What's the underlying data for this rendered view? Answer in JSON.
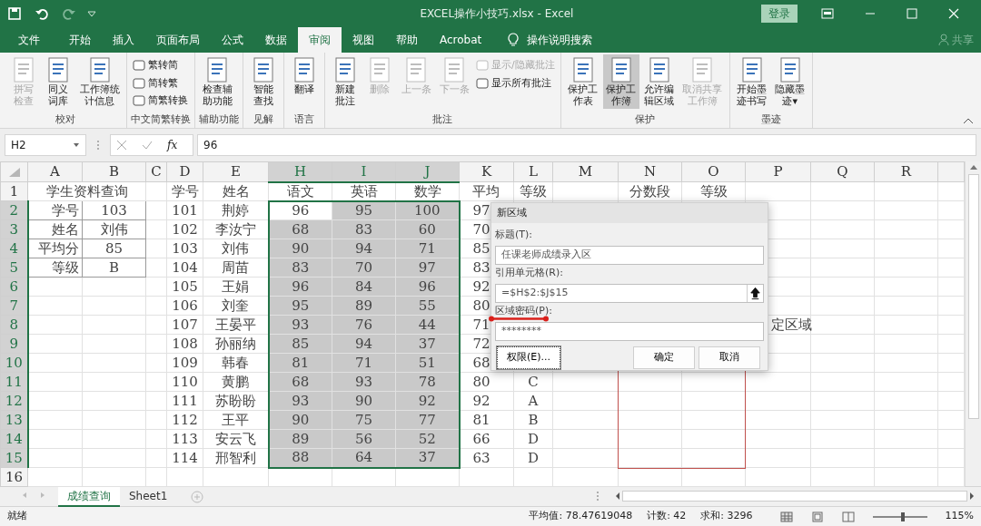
{
  "title_bar": {
    "title": "EXCEL操作小技巧.xlsx  -  Excel",
    "login": "登录"
  },
  "menu_tabs": [
    {
      "label": "文件",
      "selected": false
    },
    {
      "label": "开始",
      "selected": false
    },
    {
      "label": "插入",
      "selected": false
    },
    {
      "label": "页面布局",
      "selected": false
    },
    {
      "label": "公式",
      "selected": false
    },
    {
      "label": "数据",
      "selected": false
    },
    {
      "label": "审阅",
      "selected": true
    },
    {
      "label": "视图",
      "selected": false
    },
    {
      "label": "帮助",
      "selected": false
    },
    {
      "label": "Acrobat",
      "selected": false
    }
  ],
  "tell_me": "操作说明搜索",
  "share": "共享",
  "ribbon": [
    {
      "label": "校对",
      "buttons": [
        {
          "kind": "large",
          "label": "拼写检查",
          "disabled": true,
          "selected": false
        },
        {
          "kind": "large",
          "label": "同义词库",
          "disabled": false,
          "selected": false
        },
        {
          "kind": "large",
          "label": "工作簿统计信息",
          "disabled": false,
          "selected": false
        }
      ]
    },
    {
      "label": "中文简繁转换",
      "buttons": [
        {
          "kind": "small",
          "label": "繁转简",
          "disabled": false,
          "selected": false
        },
        {
          "kind": "small",
          "label": "简转繁",
          "disabled": false,
          "selected": false
        },
        {
          "kind": "small",
          "label": "简繁转换",
          "disabled": false,
          "selected": false
        }
      ]
    },
    {
      "label": "辅助功能",
      "buttons": [
        {
          "kind": "large",
          "label": "检查辅助功能",
          "disabled": false,
          "selected": false
        }
      ]
    },
    {
      "label": "见解",
      "buttons": [
        {
          "kind": "large",
          "label": "智能查找",
          "disabled": false,
          "selected": false
        }
      ]
    },
    {
      "label": "语言",
      "buttons": [
        {
          "kind": "large",
          "label": "翻译",
          "disabled": false,
          "selected": false
        }
      ]
    },
    {
      "label": "批注",
      "buttons": [
        {
          "kind": "large",
          "label": "新建批注",
          "disabled": false,
          "selected": false
        },
        {
          "kind": "large",
          "label": "删除",
          "disabled": true,
          "selected": false
        },
        {
          "kind": "large",
          "label": "上一条",
          "disabled": true,
          "selected": false
        },
        {
          "kind": "large",
          "label": "下一条",
          "disabled": true,
          "selected": false
        },
        {
          "kind": "small",
          "label": "显示/隐藏批注",
          "disabled": true,
          "selected": false
        },
        {
          "kind": "small",
          "label": "显示所有批注",
          "disabled": false,
          "selected": false
        }
      ]
    },
    {
      "label": "保护",
      "buttons": [
        {
          "kind": "large",
          "label": "保护工作表",
          "disabled": false,
          "selected": false
        },
        {
          "kind": "large",
          "label": "保护工作簿",
          "disabled": false,
          "selected": true
        },
        {
          "kind": "large",
          "label": "允许编辑区域",
          "disabled": false,
          "selected": false
        },
        {
          "kind": "large",
          "label": "取消共享工作簿",
          "disabled": true,
          "selected": false
        }
      ]
    },
    {
      "label": "墨迹",
      "buttons": [
        {
          "kind": "large",
          "label": "开始墨迹书写",
          "disabled": false,
          "selected": false
        },
        {
          "kind": "large",
          "label": "隐藏墨迹▾",
          "disabled": false,
          "selected": false
        }
      ]
    }
  ],
  "formula_bar": {
    "name_box": "H2",
    "function_label": "fx",
    "value": "96"
  },
  "sheet": {
    "columns": [
      {
        "letter": "A",
        "selected": false
      },
      {
        "letter": "B",
        "selected": false
      },
      {
        "letter": "C",
        "selected": false
      },
      {
        "letter": "D",
        "selected": false
      },
      {
        "letter": "E",
        "selected": false
      },
      {
        "letter": "H",
        "selected": true
      },
      {
        "letter": "I",
        "selected": true
      },
      {
        "letter": "J",
        "selected": true
      },
      {
        "letter": "K",
        "selected": false
      },
      {
        "letter": "L",
        "selected": false
      },
      {
        "letter": "M",
        "selected": false
      },
      {
        "letter": "N",
        "selected": false
      },
      {
        "letter": "O",
        "selected": false
      },
      {
        "letter": "P",
        "selected": false
      },
      {
        "letter": "Q",
        "selected": false
      },
      {
        "letter": "R",
        "selected": false
      }
    ],
    "rows": [
      {
        "number": "1",
        "selected": false,
        "boxed": false,
        "cells": {
          "A": {
            "text": "学生资料查询",
            "merged": true
          },
          "D": "学号",
          "E": "姓名",
          "H": "语文",
          "I": "英语",
          "J": "数学",
          "K": "平均",
          "L": "等级",
          "N": "分数段",
          "O": "等级"
        }
      },
      {
        "number": "2",
        "selected": true,
        "boxed": true,
        "cells": {
          "A": "学号",
          "B": "103",
          "D": "101",
          "E": "荆婷",
          "H": "96",
          "I": "95",
          "J": "100",
          "K": "97"
        }
      },
      {
        "number": "3",
        "selected": true,
        "boxed": true,
        "cells": {
          "A": "姓名",
          "B": "刘伟",
          "D": "102",
          "E": "李汝宁",
          "H": "68",
          "I": "83",
          "J": "60",
          "K": "70"
        }
      },
      {
        "number": "4",
        "selected": true,
        "boxed": true,
        "cells": {
          "A": "平均分",
          "B": "85",
          "D": "103",
          "E": "刘伟",
          "H": "90",
          "I": "94",
          "J": "71",
          "K": "85"
        }
      },
      {
        "number": "5",
        "selected": true,
        "boxed": true,
        "cells": {
          "A": "等级",
          "B": "B",
          "D": "104",
          "E": "周苗",
          "H": "83",
          "I": "70",
          "J": "97",
          "K": "83"
        }
      },
      {
        "number": "6",
        "selected": true,
        "boxed": false,
        "cells": {
          "D": "105",
          "E": "王娟",
          "H": "96",
          "I": "84",
          "J": "96",
          "K": "92"
        }
      },
      {
        "number": "7",
        "selected": true,
        "boxed": false,
        "cells": {
          "D": "106",
          "E": "刘奎",
          "H": "95",
          "I": "89",
          "J": "55",
          "K": "80"
        }
      },
      {
        "number": "8",
        "selected": true,
        "boxed": false,
        "cells": {
          "D": "107",
          "E": "王晏平",
          "H": "93",
          "I": "76",
          "J": "44",
          "K": "71",
          "P": "定区域"
        }
      },
      {
        "number": "9",
        "selected": true,
        "boxed": false,
        "cells": {
          "D": "108",
          "E": "孙丽纳",
          "H": "85",
          "I": "94",
          "J": "37",
          "K": "72"
        }
      },
      {
        "number": "10",
        "selected": true,
        "boxed": false,
        "cells": {
          "D": "109",
          "E": "韩春",
          "H": "81",
          "I": "71",
          "J": "51",
          "K": "68"
        }
      },
      {
        "number": "11",
        "selected": true,
        "boxed": false,
        "cells": {
          "D": "110",
          "E": "黄鹏",
          "H": "68",
          "I": "93",
          "J": "78",
          "K": "80",
          "L": "C"
        }
      },
      {
        "number": "12",
        "selected": true,
        "boxed": false,
        "cells": {
          "D": "111",
          "E": "苏盼盼",
          "H": "93",
          "I": "90",
          "J": "92",
          "K": "92",
          "L": "A"
        }
      },
      {
        "number": "13",
        "selected": true,
        "boxed": false,
        "cells": {
          "D": "112",
          "E": "王平",
          "H": "90",
          "I": "75",
          "J": "77",
          "K": "81",
          "L": "B"
        }
      },
      {
        "number": "14",
        "selected": true,
        "boxed": false,
        "cells": {
          "D": "113",
          "E": "安云飞",
          "H": "89",
          "I": "56",
          "J": "52",
          "K": "66",
          "L": "D"
        }
      },
      {
        "number": "15",
        "selected": true,
        "boxed": false,
        "cells": {
          "D": "114",
          "E": "邢智利",
          "H": "88",
          "I": "64",
          "J": "37",
          "K": "63",
          "L": "D"
        }
      },
      {
        "number": "16",
        "selected": false,
        "boxed": false,
        "cells": {}
      }
    ]
  },
  "annotations": {
    "outline_box": true,
    "label_underline": true
  },
  "dialog": {
    "title": "新区域",
    "fields": [
      {
        "label": "标题(T):",
        "value": "任课老师成绩录入区",
        "picker": false
      },
      {
        "label": "引用单元格(R):",
        "value": "=$H$2:$J$15",
        "picker": true
      },
      {
        "label": "区域密码(P):",
        "value": "********",
        "picker": false
      }
    ],
    "buttons": [
      {
        "label": "权限(E)...",
        "focused": true
      },
      {
        "label": "确定",
        "focused": false
      },
      {
        "label": "取消",
        "focused": false
      }
    ]
  },
  "sheet_tabs": [
    {
      "label": "成绩查询",
      "selected": true
    },
    {
      "label": "Sheet1",
      "selected": false
    }
  ],
  "status_bar": {
    "ready": "就绪",
    "stats": [
      "平均值: 78.47619048",
      "计数: 42",
      "求和: 3296"
    ],
    "zoom_slider": {
      "level": 0.55
    },
    "zoom": "115%"
  }
}
